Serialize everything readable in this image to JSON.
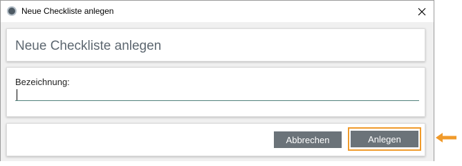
{
  "window": {
    "title": "Neue Checkliste anlegen",
    "app_icon": "app-icon",
    "close_icon": "close-icon"
  },
  "header": {
    "heading": "Neue Checkliste anlegen"
  },
  "form": {
    "label": "Bezeichnung:",
    "value": "",
    "placeholder": ""
  },
  "actions": {
    "cancel_label": "Abbrechen",
    "create_label": "Anlegen"
  },
  "annotation": {
    "icon": "arrow-left-icon",
    "color": "#f09a2a"
  },
  "colors": {
    "button": "#6b7379",
    "accent_underline": "#4f7f7a",
    "highlight": "#f09a2a"
  }
}
